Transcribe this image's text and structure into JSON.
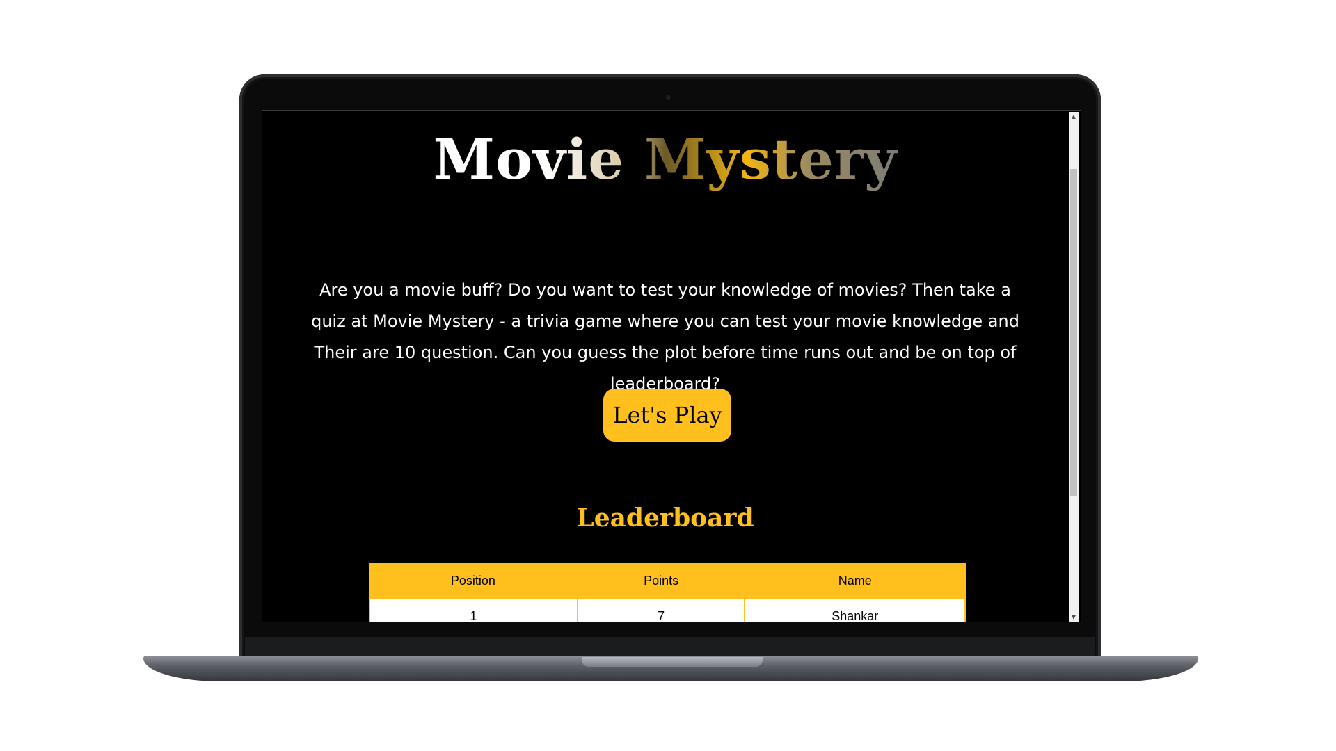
{
  "site": {
    "title": "Movie Mystery",
    "intro": "Are you a movie buff? Do you want to test your knowledge of movies? Then take a quiz at Movie Mystery - a trivia game where you can test your movie knowledge and Their are 10 question. Can you guess the plot before time runs out and be on top of leaderboard?",
    "play_button_label": "Let's Play"
  },
  "leaderboard": {
    "title": "Leaderboard",
    "columns": [
      "Position",
      "Points",
      "Name"
    ],
    "rows": [
      [
        "1",
        "7",
        "Shankar"
      ]
    ]
  },
  "scrollbar": {
    "up_icon": "scroll-up-arrow",
    "down_icon": "scroll-down-arrow"
  },
  "colors": {
    "accent": "#ffc01e",
    "background": "#000000",
    "text": "#ffffff"
  }
}
